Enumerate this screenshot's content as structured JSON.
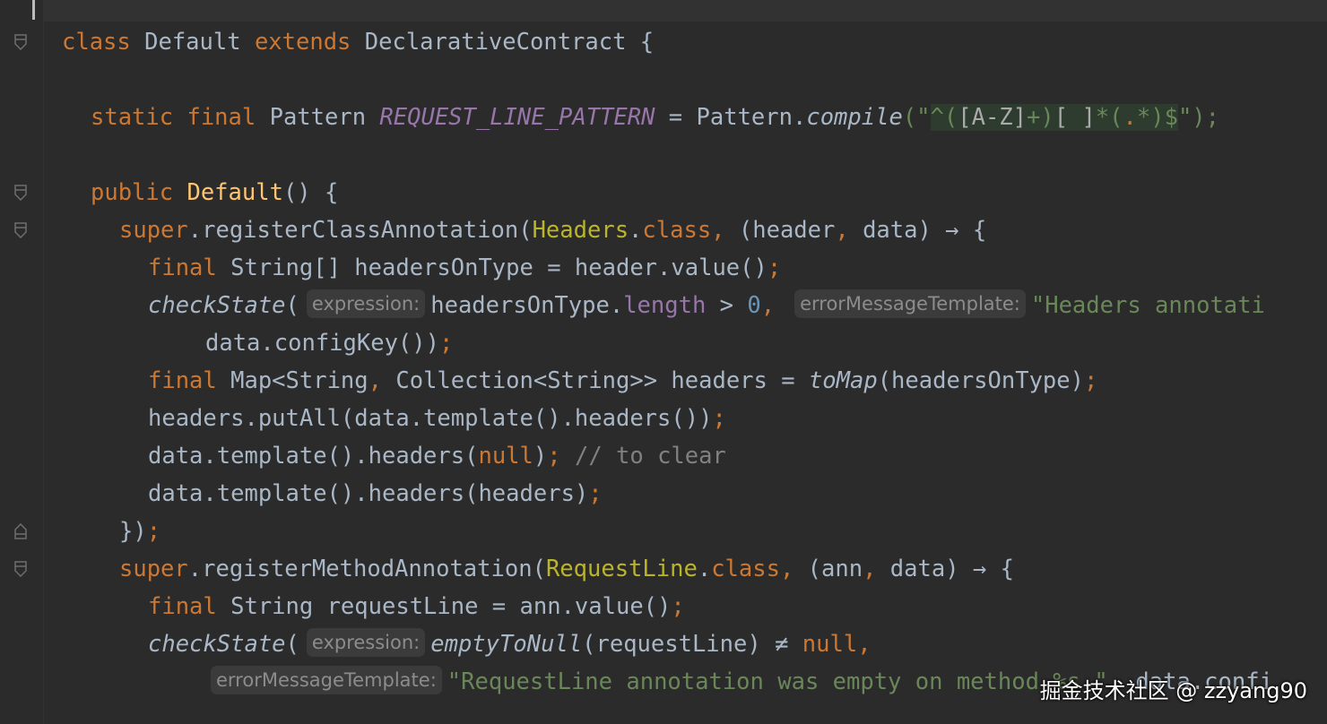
{
  "editor": {
    "lines": {
      "l1": {
        "t1": "class",
        "t2": " Default ",
        "t3": "extends",
        "t4": " DeclarativeContract {"
      },
      "l3": {
        "t1": "static final",
        "t2": " Pattern ",
        "t3": "REQUEST_LINE_PATTERN",
        "t4": " = Pattern.",
        "t5": "compile",
        "t6": "(\"",
        "r1": "^(",
        "r2": "[A-Z]",
        "r3": "+)",
        "r4": "[ ]",
        "r5": "*(",
        "r6": ".",
        "r7": "*)$",
        "t7": "\");"
      },
      "l5": {
        "t1": "public ",
        "t2": "Default",
        "t3": "() {"
      },
      "l6": {
        "t1": "super",
        "t2": ".registerClassAnnotation(",
        "t3": "Headers",
        "t4": ".",
        "t5": "class",
        "t6": ",",
        "t7": " (header",
        "t8": ",",
        "t9": " data) → {"
      },
      "l7": {
        "t1": "final",
        "t2": " String[] headersOnType = header.value()",
        "t3": ";"
      },
      "l8": {
        "t1": "checkState",
        "t2": "(",
        "h1": "expression:",
        "t3": "headersOnType.",
        "t4": "length",
        "t5": " > ",
        "t6": "0",
        "t7": ",",
        "h2": "errorMessageTemplate:",
        "t8": "\"Headers annotati"
      },
      "l9": {
        "t1": "data.configKey())",
        "t2": ";"
      },
      "l10": {
        "t1": "final",
        "t2": " Map<String",
        "t3": ",",
        "t4": " Collection<String>> headers = ",
        "t5": "toMap",
        "t6": "(headersOnType)",
        "t7": ";"
      },
      "l11": {
        "t1": "headers.putAll(data.template().headers())",
        "t2": ";"
      },
      "l12": {
        "t1": "data.template().headers(",
        "t2": "null",
        "t3": ")",
        "t4": ";",
        "t5": " // to clear"
      },
      "l13": {
        "t1": "data.template().headers(headers)",
        "t2": ";"
      },
      "l14": {
        "t1": "})",
        "t2": ";"
      },
      "l15": {
        "t1": "super",
        "t2": ".registerMethodAnnotation(",
        "t3": "RequestLine",
        "t4": ".",
        "t5": "class",
        "t6": ",",
        "t7": " (ann",
        "t8": ",",
        "t9": " data) → {"
      },
      "l16": {
        "t1": "final",
        "t2": " String requestLine = ann.value()",
        "t3": ";"
      },
      "l17": {
        "t1": "checkState",
        "t2": "(",
        "h1": "expression:",
        "t3": "emptyToNull",
        "t4": "(requestLine) ≠ ",
        "t5": "null",
        "t6": ","
      },
      "l18": {
        "h1": "errorMessageTemplate:",
        "t1": "\"RequestLine annotation was empty on method %s.\"",
        "t2": ", data.confi"
      }
    }
  },
  "watermark": "掘金技术社区 @ zzyang90"
}
